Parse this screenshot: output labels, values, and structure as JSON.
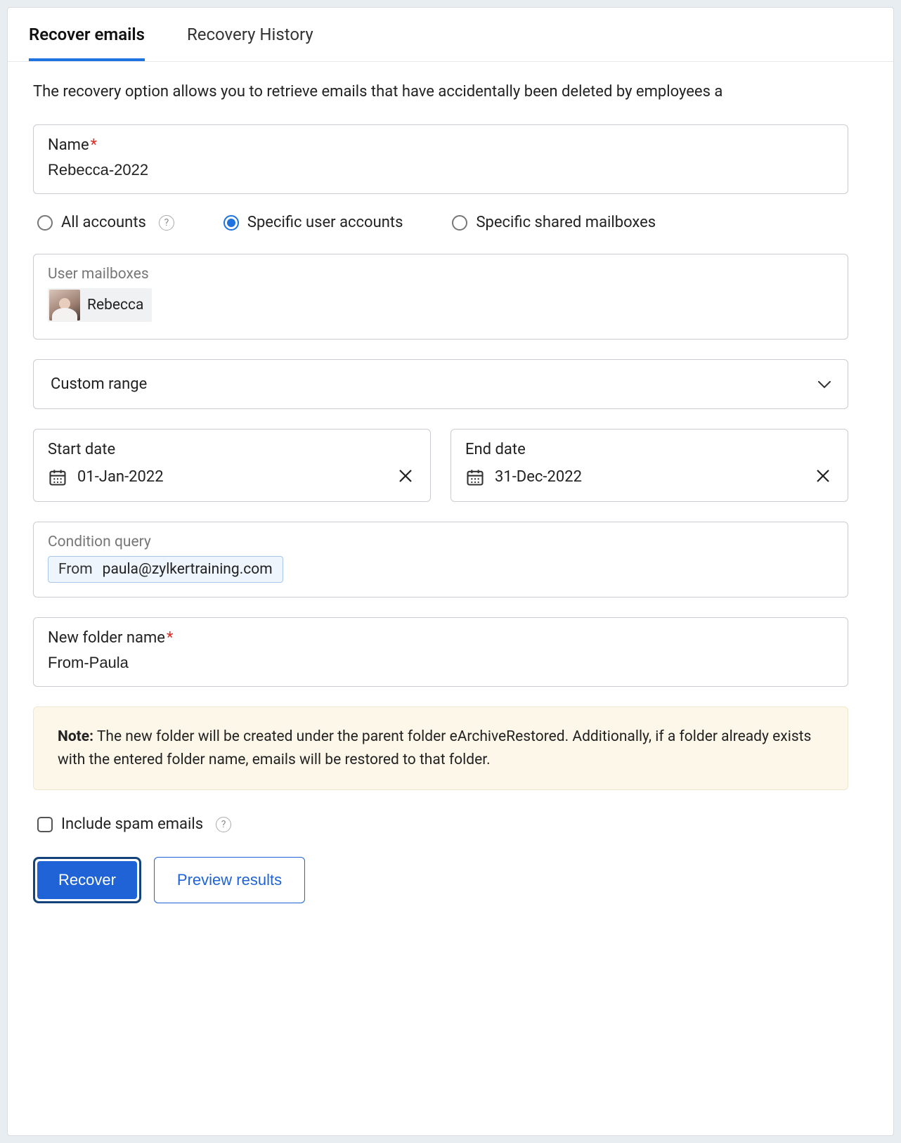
{
  "tabs": {
    "recover": "Recover emails",
    "history": "Recovery History"
  },
  "description": "The recovery option allows you to retrieve emails that have accidentally been deleted by employees a",
  "name_field": {
    "label": "Name",
    "value": "Rebecca-2022"
  },
  "account_scope": {
    "all": "All accounts",
    "specific_users": "Specific user accounts",
    "specific_shared": "Specific shared mailboxes"
  },
  "user_mailboxes": {
    "label": "User mailboxes",
    "chip_name": "Rebecca"
  },
  "range_select": "Custom range",
  "start_date": {
    "label": "Start date",
    "value": "01-Jan-2022"
  },
  "end_date": {
    "label": "End date",
    "value": "31-Dec-2022"
  },
  "condition": {
    "label": "Condition query",
    "key": "From",
    "value": "paula@zylkertraining.com"
  },
  "folder": {
    "label": "New folder name",
    "value": "From-Paula"
  },
  "note": {
    "prefix": "Note:",
    "body": " The new folder will be created under the parent folder eArchiveRestored. Additionally, if a folder already exists with the entered folder name, emails will be restored to that folder."
  },
  "include_spam": "Include spam emails",
  "buttons": {
    "recover": "Recover",
    "preview": "Preview results"
  }
}
